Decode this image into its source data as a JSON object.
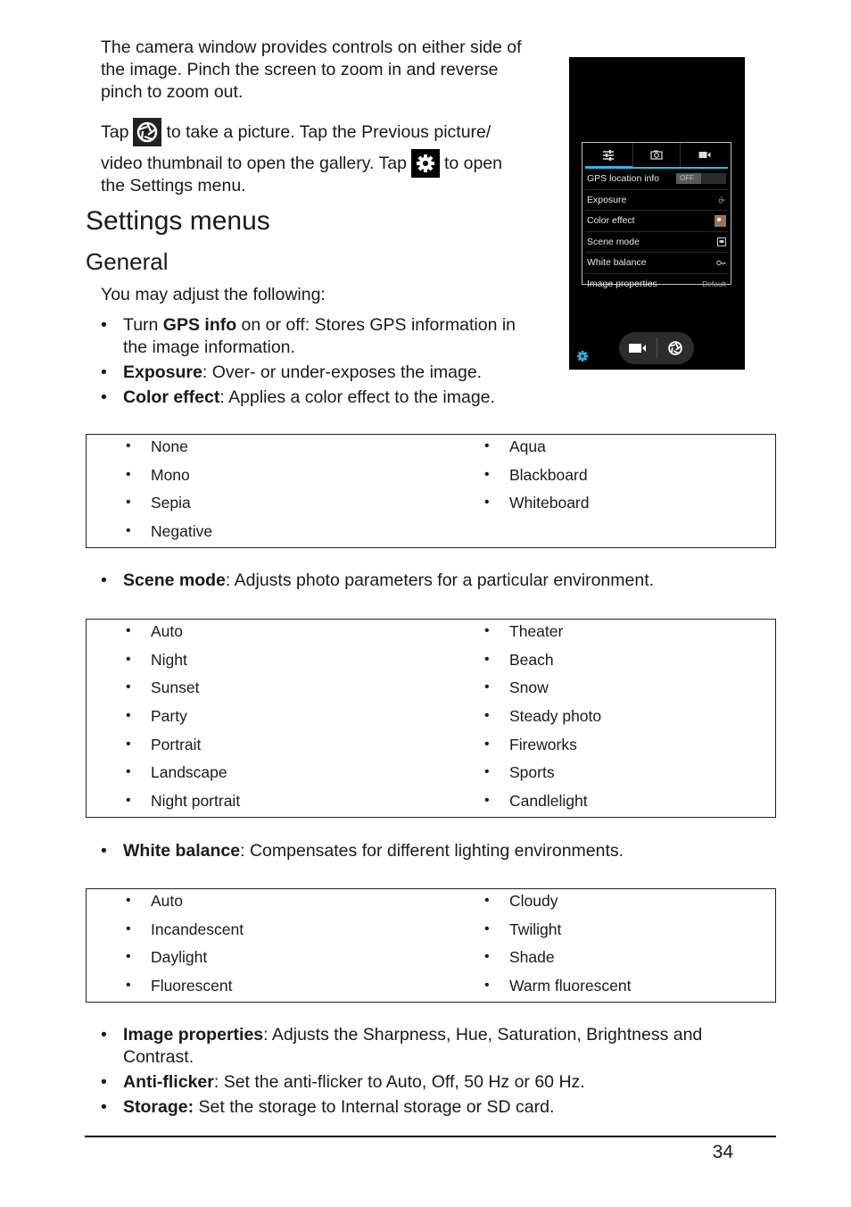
{
  "intro": {
    "paragraph": "The camera window provides controls on either side of the image. Pinch the screen to zoom in and reverse pinch to zoom out.",
    "tap_line1_before": "Tap",
    "tap_line1_after": "to take a picture. Tap the Previous picture/",
    "tap_line2_before": "video thumbnail to open the gallery. Tap",
    "tap_line2_after": "to open",
    "tap_line3": "the Settings menu.",
    "icons": [
      "shutter-icon",
      "gear-icon"
    ]
  },
  "heading": "Settings menus",
  "subheading": "General",
  "you_may": "You may adjust the following:",
  "list1": [
    {
      "bold": "GPS info",
      "pre": "Turn ",
      "text": " on or off: Stores GPS information in the image information."
    },
    {
      "bold": "Exposure",
      "pre": "",
      "text": ": Over- or under-exposes the image."
    },
    {
      "bold": "Color effect",
      "pre": "",
      "text": ": Applies a color effect to the image."
    }
  ],
  "color_effects": {
    "col1": [
      "None",
      "Mono",
      "Sepia",
      "Negative"
    ],
    "col2": [
      "Aqua",
      "Blackboard",
      "Whiteboard"
    ]
  },
  "scene_line": {
    "bold": "Scene mode",
    "text": ": Adjusts photo parameters for a particular environment."
  },
  "scene_modes": {
    "col1": [
      "Auto",
      "Night",
      "Sunset",
      "Party",
      "Portrait",
      "Landscape",
      "Night portrait"
    ],
    "col2": [
      "Theater",
      "Beach",
      "Snow",
      "Steady photo",
      "Fireworks",
      "Sports",
      "Candlelight"
    ]
  },
  "wb_line": {
    "bold": "White balance",
    "text": ": Compensates for different lighting environments."
  },
  "white_balance": {
    "col1": [
      "Auto",
      "Incandescent",
      "Daylight",
      "Fluorescent"
    ],
    "col2": [
      "Cloudy",
      "Twilight",
      "Shade",
      "Warm fluorescent"
    ]
  },
  "list_end": [
    {
      "bold": "Image properties",
      "text": ": Adjusts the Sharpness, Hue, Saturation, Brightness and Contrast."
    },
    {
      "bold": "Anti-flicker",
      "text": ": Set the anti-flicker to Auto, Off, 50 Hz or 60 Hz."
    },
    {
      "bold": "Storage:",
      "text": " Set the storage to Internal storage or SD card."
    }
  ],
  "page_number": "34",
  "phone": {
    "tabs": [
      "settings-sliders-icon",
      "camera-icon",
      "video-camera-icon"
    ],
    "rows": [
      {
        "label": "GPS location info",
        "value": "OFF",
        "kind": "toggle"
      },
      {
        "label": "Exposure",
        "value": "exposure-icon",
        "kind": "icon"
      },
      {
        "label": "Color effect",
        "value": "color-effect-icon",
        "kind": "icon"
      },
      {
        "label": "Scene mode",
        "value": "scene-mode-icon",
        "kind": "icon"
      },
      {
        "label": "White balance",
        "value": "white-balance-icon",
        "kind": "icon"
      },
      {
        "label": "Image properties",
        "value": "Default",
        "kind": "text"
      }
    ],
    "accent": "#33b5e5"
  }
}
